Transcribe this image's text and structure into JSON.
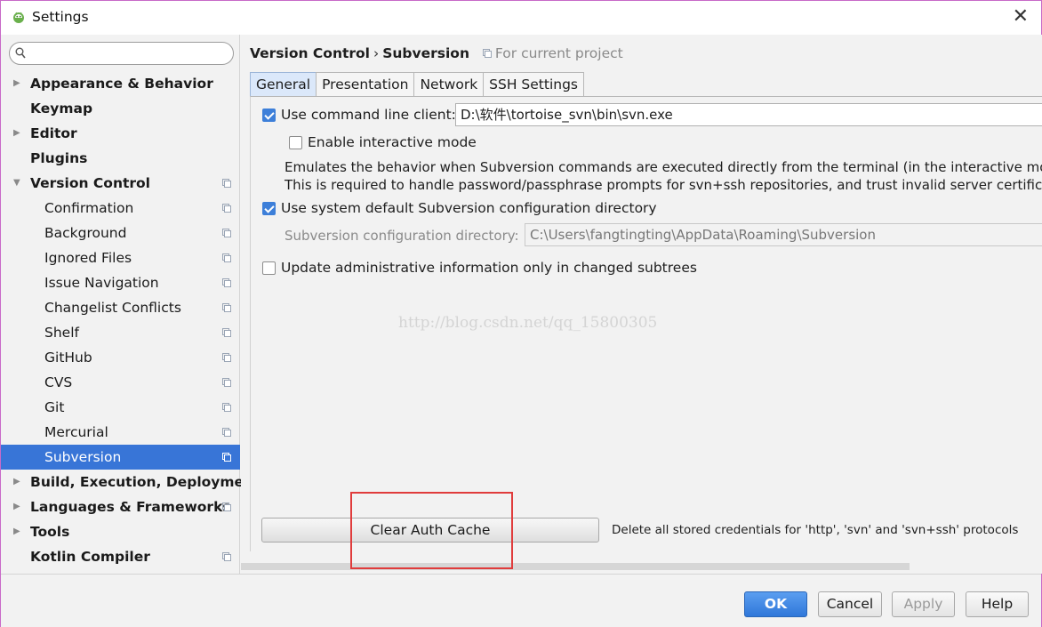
{
  "window": {
    "title": "Settings"
  },
  "sidebar": {
    "search_placeholder": "",
    "items": [
      {
        "label": "Appearance & Behavior",
        "level": "top",
        "arrow": "▶",
        "project": false
      },
      {
        "label": "Keymap",
        "level": "top",
        "arrow": "",
        "project": false
      },
      {
        "label": "Editor",
        "level": "top",
        "arrow": "▶",
        "project": false
      },
      {
        "label": "Plugins",
        "level": "top",
        "arrow": "",
        "project": false
      },
      {
        "label": "Version Control",
        "level": "top",
        "arrow": "▼",
        "project": true
      },
      {
        "label": "Confirmation",
        "level": "sub",
        "arrow": "",
        "project": true
      },
      {
        "label": "Background",
        "level": "sub",
        "arrow": "",
        "project": true
      },
      {
        "label": "Ignored Files",
        "level": "sub",
        "arrow": "",
        "project": true
      },
      {
        "label": "Issue Navigation",
        "level": "sub",
        "arrow": "",
        "project": true
      },
      {
        "label": "Changelist Conflicts",
        "level": "sub",
        "arrow": "",
        "project": true
      },
      {
        "label": "Shelf",
        "level": "sub",
        "arrow": "",
        "project": true
      },
      {
        "label": "GitHub",
        "level": "sub",
        "arrow": "",
        "project": true
      },
      {
        "label": "CVS",
        "level": "sub",
        "arrow": "",
        "project": true
      },
      {
        "label": "Git",
        "level": "sub",
        "arrow": "",
        "project": true
      },
      {
        "label": "Mercurial",
        "level": "sub",
        "arrow": "",
        "project": true
      },
      {
        "label": "Subversion",
        "level": "sub",
        "arrow": "",
        "project": true,
        "selected": true
      },
      {
        "label": "Build, Execution, Deployment",
        "level": "top",
        "arrow": "▶",
        "project": false
      },
      {
        "label": "Languages & Frameworks",
        "level": "top",
        "arrow": "▶",
        "project": true
      },
      {
        "label": "Tools",
        "level": "top",
        "arrow": "▶",
        "project": false
      },
      {
        "label": "Kotlin Compiler",
        "level": "top",
        "arrow": "",
        "project": true
      }
    ]
  },
  "header": {
    "crumb1": "Version Control",
    "separator": "›",
    "crumb2": "Subversion",
    "scope": "For current project"
  },
  "tabs": [
    "General",
    "Presentation",
    "Network",
    "SSH Settings"
  ],
  "general": {
    "use_cmd_label": "Use command line client:",
    "use_cmd_checked": true,
    "cmd_path": "D:\\软件\\tortoise_svn\\bin\\svn.exe",
    "interactive_label": "Enable interactive mode",
    "interactive_checked": false,
    "desc_line1": "Emulates the behavior when Subversion commands are executed directly from the terminal (in the interactive mode).",
    "desc_line2": "This is required to handle password/passphrase prompts for svn+ssh repositories, and trust invalid server certificates",
    "use_sys_label": "Use system default Subversion configuration directory",
    "use_sys_checked": true,
    "config_dir_label": "Subversion configuration directory:",
    "config_dir_value": "C:\\Users\\fangtingting\\AppData\\Roaming\\Subversion",
    "update_admin_label": "Update administrative information only in changed subtrees",
    "update_admin_checked": false,
    "watermark": "http://blog.csdn.net/qq_15800305",
    "clear_auth_label": "Clear Auth Cache",
    "clear_auth_desc": "Delete all stored credentials for 'http', 'svn' and 'svn+ssh' protocols"
  },
  "footer": {
    "ok": "OK",
    "cancel": "Cancel",
    "apply": "Apply",
    "help": "Help"
  },
  "colors": {
    "selection": "#3875d7",
    "primary_button": "#2f77d9",
    "annotation_box": "#e03c3c"
  }
}
